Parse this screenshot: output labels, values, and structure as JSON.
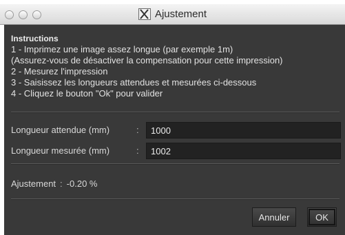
{
  "window": {
    "title": "Ajustement"
  },
  "instructions": {
    "heading": "Instructions",
    "lines": [
      "1 - Imprimez une image assez longue (par exemple 1m)",
      "(Assurez-vous de désactiver la compensation pour cette impression)",
      "2 - Mesurez l'impression",
      "3 - Saisissez les longueurs attendues et mesurées ci-dessous",
      "4 - Cliquez le bouton \"Ok\" pour valider"
    ]
  },
  "fields": {
    "expected": {
      "label": "Longueur attendue (mm)",
      "separator": ":",
      "value": "1000"
    },
    "measured": {
      "label": "Longueur mesurée (mm)",
      "separator": ":",
      "value": "1002"
    }
  },
  "adjustment": {
    "label": "Ajustement",
    "separator": ":",
    "value": "-0.20 %"
  },
  "buttons": {
    "cancel": "Annuler",
    "ok": "OK"
  },
  "colors": {
    "panel_background": "#393939",
    "input_background": "#222222",
    "text": "#e0e0e0"
  },
  "icons": {
    "title": "x11-icon"
  }
}
